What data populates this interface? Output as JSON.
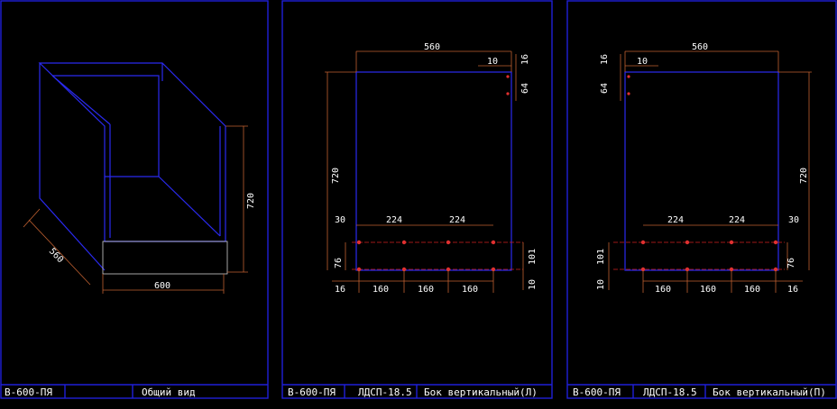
{
  "sheets": [
    {
      "code": "В-600-ПЯ",
      "material": "",
      "name": "Общий вид",
      "dims": {
        "height": "720",
        "depth": "560",
        "width": "600"
      }
    },
    {
      "code": "В-600-ПЯ",
      "material": "ЛДСП-18.5",
      "name": "Бок вертикальный(Л)",
      "dims": {
        "width": "560",
        "height": "720",
        "offset_top": "10",
        "top_16": "16",
        "top_64": "64",
        "row_30": "30",
        "row_224a": "224",
        "row_224b": "224",
        "row_76": "76",
        "row_101": "101",
        "bot_16": "16",
        "bot_160a": "160",
        "bot_160b": "160",
        "bot_160c": "160",
        "bot_10": "10"
      }
    },
    {
      "code": "В-600-ПЯ",
      "material": "ЛДСП-18.5",
      "name": "Бок вертикальный(П)",
      "dims": {
        "width": "560",
        "height": "720",
        "offset_top": "10",
        "top_16": "16",
        "top_64": "64",
        "row_30": "30",
        "row_224a": "224",
        "row_224b": "224",
        "row_76": "76",
        "row_101": "101",
        "bot_16": "16",
        "bot_160a": "160",
        "bot_160b": "160",
        "bot_160c": "160",
        "bot_10": "10"
      }
    }
  ],
  "colors": {
    "frame": "#1f1fd8",
    "part": "#2a2af0",
    "dimension": "#c06030",
    "holes": "#d02020"
  }
}
